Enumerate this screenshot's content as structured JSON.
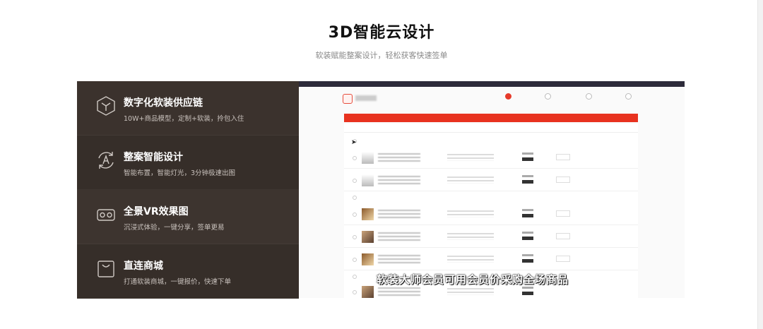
{
  "header": {
    "title": "3D智能云设计",
    "subtitle": "软装赋能整案设计，轻松获客快速签单"
  },
  "features": [
    {
      "icon": "cube-icon",
      "title": "数字化软装供应链",
      "desc": "10W+商品模型，定制+软装，拎包入住"
    },
    {
      "icon": "ai-refresh-icon",
      "title": "整案智能设计",
      "desc": "智能布置，智能灯光，3分钟极速出图"
    },
    {
      "icon": "vr-headset-icon",
      "title": "全景VR效果图",
      "desc": "沉浸式体验，一键分享，签单更易"
    },
    {
      "icon": "shopping-bag-icon",
      "title": "直连商城",
      "desc": "打通软装商城，一键报价，快速下单"
    }
  ],
  "screenshot": {
    "caption": "软装大师会员可用会员价采购全场商品"
  },
  "colors": {
    "panel": "#3b322d",
    "accent_red": "#e8321f",
    "link_blue": "#3a7bd5"
  }
}
